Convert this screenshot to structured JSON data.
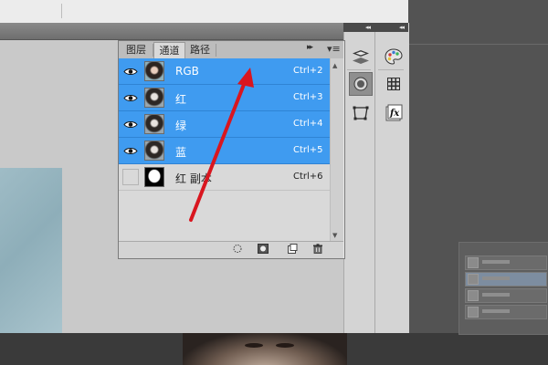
{
  "panel": {
    "tabs": [
      {
        "label": "图层",
        "active": false
      },
      {
        "label": "通道",
        "active": true
      },
      {
        "label": "路径",
        "active": false
      }
    ],
    "arrows_glyph": "▸▸",
    "menu_glyph": "▾≡"
  },
  "channels": [
    {
      "name": "RGB",
      "shortcut": "Ctrl+2",
      "selected": true,
      "visible": true,
      "thumb": "color"
    },
    {
      "name": "红",
      "shortcut": "Ctrl+3",
      "selected": true,
      "visible": true,
      "thumb": "gray"
    },
    {
      "name": "绿",
      "shortcut": "Ctrl+4",
      "selected": true,
      "visible": true,
      "thumb": "gray"
    },
    {
      "name": "蓝",
      "shortcut": "Ctrl+5",
      "selected": true,
      "visible": true,
      "thumb": "gray"
    },
    {
      "name": "红 副本",
      "shortcut": "Ctrl+6",
      "selected": false,
      "visible": false,
      "thumb": "mask"
    }
  ],
  "footer_icons": [
    "load-selection-icon",
    "save-selection-icon",
    "new-channel-icon",
    "trash-icon"
  ],
  "dock": {
    "collapse_glyph": "◂◂",
    "left_icons": [
      "layers-icon",
      "channels-icon",
      "paths-icon"
    ],
    "right_icons": [
      "color-palette-icon",
      "swatches-icon",
      "styles-icon"
    ],
    "styles_label": "fx"
  },
  "colors": {
    "selection": "#3f9bf0",
    "annotation_arrow": "#d9161f"
  }
}
